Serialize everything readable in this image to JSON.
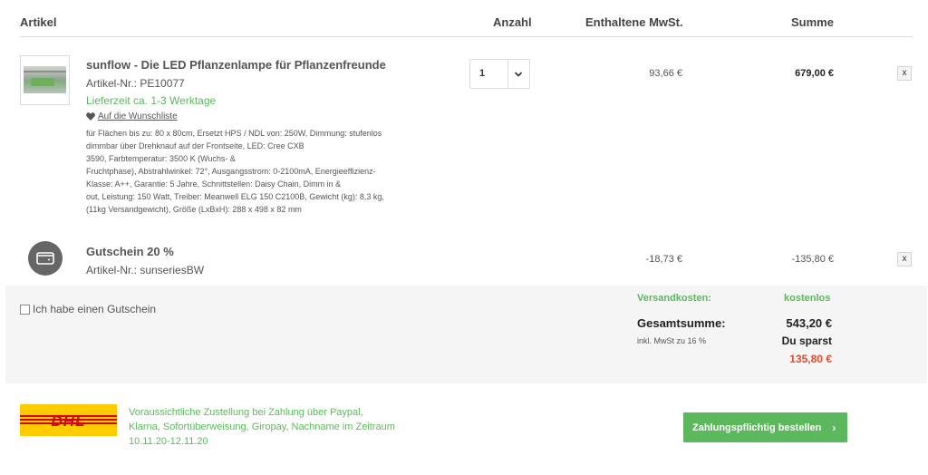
{
  "header": {
    "article": "Artikel",
    "quantity": "Anzahl",
    "vat": "Enthaltene MwSt.",
    "sum": "Summe"
  },
  "product": {
    "title": "sunflow - Die LED Pflanzenlampe für Pflanzenfreunde",
    "article_no": "Artikel-Nr.: PE10077",
    "delivery": "Lieferzeit ca. 1-3 Werktage",
    "wishlist": "Auf die Wunschliste",
    "description_lines": [
      "für Flächen bis zu: 80 x 80cm, Ersetzt HPS / NDL von: 250W, Dimmung: stufenlos",
      "dimmbar über Drehknauf auf der Frontseite, LED: Cree CXB",
      "3590, Farbtemperatur: 3500 K (Wuchs- &",
      "Fruchtphase), Abstrahlwinkel: 72°, Ausgangsstrom: 0-2100mA, Energieeffizienz-",
      "Klasse: A++, Garantie: 5 Jahre, Schnittstellen: Daisy Chain, Dimm in &",
      "out, Leistung: 150 Watt, Treiber: Meanwell ELG 150 C2100B, Gewicht (kg): 8,3 kg,",
      "(11kg Versandgewicht), Größe (LxBxH): 288 x 498 x 82 mm"
    ],
    "quantity": "1",
    "vat": "93,66 €",
    "sum": "679,00 €",
    "remove": "x"
  },
  "voucher": {
    "title": "Gutschein 20 %",
    "article_no": "Artikel-Nr.: sunseriesBW",
    "vat": "-18,73 €",
    "sum": "-135,80 €",
    "remove": "x"
  },
  "summary": {
    "voucher_checkbox": "Ich habe einen Gutschein",
    "shipping_label": "Versandkosten:",
    "shipping_value": "kostenlos",
    "total_label": "Gesamtsumme:",
    "total_value": "543,20 €",
    "incl_vat": "inkl. MwSt zu 16 %",
    "save_label": "Du sparst",
    "save_value": "135,80 €"
  },
  "footer": {
    "carrier_logo": "DHL",
    "delivery_lines": [
      "Voraussichtliche Zustellung bei Zahlung über Paypal,",
      "Klarna, Sofortüberweisung, Giropay, Nachname im Zeitraum",
      "10.11.20-12.11.20"
    ],
    "order_button": "Zahlungspflichtig bestellen",
    "order_arrow": "›"
  },
  "colors": {
    "accent_green": "#5cb85c",
    "savings_red": "#e8492f",
    "dhl_yellow": "#ffcc00",
    "dhl_red": "#d40511"
  }
}
